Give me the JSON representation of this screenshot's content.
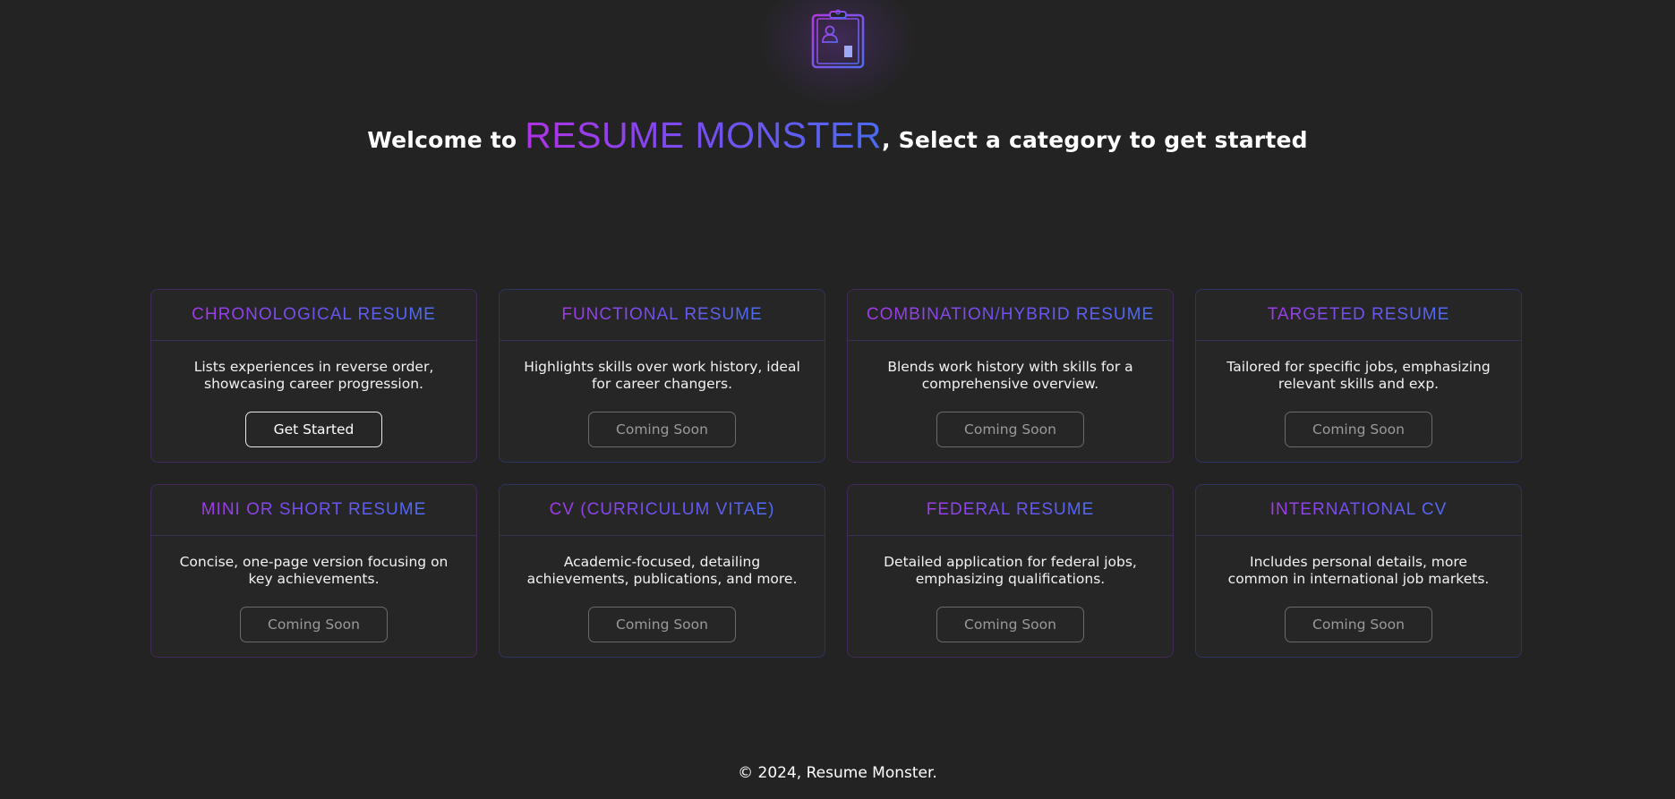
{
  "logo": {
    "icon": "resume-clipboard-icon"
  },
  "header": {
    "welcome_prefix": "Welcome to ",
    "brand": "RESUME MONSTER",
    "welcome_suffix": ", Select a category to get started"
  },
  "categories": [
    {
      "title": "CHRONOLOGICAL RESUME",
      "description": "Lists experiences in reverse order, showcasing career progression.",
      "button": "Get Started",
      "enabled": true
    },
    {
      "title": "FUNCTIONAL RESUME",
      "description": "Highlights skills over work history, ideal for career changers.",
      "button": "Coming Soon",
      "enabled": false
    },
    {
      "title": "COMBINATION/HYBRID RESUME",
      "description": "Blends work history with skills for a comprehensive overview.",
      "button": "Coming Soon",
      "enabled": false
    },
    {
      "title": "TARGETED RESUME",
      "description": "Tailored for specific jobs, emphasizing relevant skills and exp.",
      "button": "Coming Soon",
      "enabled": false
    },
    {
      "title": "MINI OR SHORT RESUME",
      "description": "Concise, one-page version focusing on key achievements.",
      "button": "Coming Soon",
      "enabled": false
    },
    {
      "title": "CV (CURRICULUM VITAE)",
      "description": "Academic-focused, detailing achievements, publications, and more.",
      "button": "Coming Soon",
      "enabled": false
    },
    {
      "title": "FEDERAL RESUME",
      "description": "Detailed application for federal jobs, emphasizing qualifications.",
      "button": "Coming Soon",
      "enabled": false
    },
    {
      "title": "INTERNATIONAL CV",
      "description": "Includes personal details, more common in international job markets.",
      "button": "Coming Soon",
      "enabled": false
    }
  ],
  "footer": {
    "text": "© 2024, Resume Monster."
  },
  "colors": {
    "background": "#232323",
    "accent_purple": "#a23ae6",
    "accent_blue": "#4e6cf2"
  }
}
